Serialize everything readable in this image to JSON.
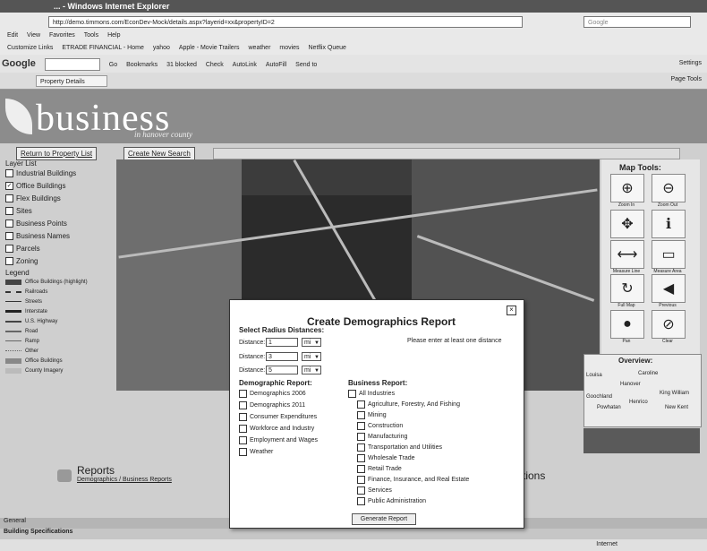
{
  "browser": {
    "title": "... - Windows Internet Explorer",
    "url": "http://demo.timmons.com/EconDev-Mock/details.aspx?layerid=xx&propertyID=2",
    "search_placeholder": "Google",
    "menu": [
      "Edit",
      "View",
      "Favorites",
      "Tools",
      "Help"
    ],
    "links": [
      "Customize Links",
      "ETRADE FINANCIAL - Home",
      "yahoo",
      "Apple - Movie Trailers",
      "weather",
      "movies",
      "Netflix Queue"
    ],
    "google_label": "Google",
    "google_items": [
      "Go",
      "Bookmarks",
      "31 blocked",
      "Check",
      "AutoLink",
      "AutoFill",
      "Send to"
    ],
    "settings": "Settings",
    "tab_label": "Property Details",
    "tab_right": "Page  Tools"
  },
  "site": {
    "logo": "business",
    "tagline": "in hanover county"
  },
  "nav": {
    "return_button": "Return to Property List",
    "new_search_button": "Create New Search"
  },
  "layers": {
    "title": "Layer List",
    "items": [
      {
        "label": "Industrial Buildings",
        "checked": false
      },
      {
        "label": "Office Buildings",
        "checked": true
      },
      {
        "label": "Flex Buildings",
        "checked": false
      },
      {
        "label": "Sites",
        "checked": false
      },
      {
        "label": "Business Points",
        "checked": false
      },
      {
        "label": "Business Names",
        "checked": false
      },
      {
        "label": "Parcels",
        "checked": false
      },
      {
        "label": "Zoning",
        "checked": false
      },
      {
        "label": "County boundary",
        "checked": false
      }
    ]
  },
  "legend": {
    "title": "Legend",
    "items": [
      "Office Buildings (highlight)",
      "Railroads",
      "Streets",
      "Interstate",
      "U.S. Highway",
      "Road",
      "Ramp",
      "Other",
      "Office Buildings",
      "County Imagery"
    ]
  },
  "map_tools": {
    "title": "Map Tools:",
    "tools": [
      "Zoom In",
      "Zoom Out",
      "Pan",
      "Identify",
      "Measure Line",
      "Measure Area",
      "Full Map",
      "Previous",
      "Pan",
      "Clear"
    ],
    "overview_title": "Overview:",
    "overview_labels": [
      "Louisa",
      "Caroline",
      "Hanover",
      "King William",
      "Goochland",
      "Powhatan",
      "New Kent",
      "Henrico"
    ]
  },
  "reports": {
    "title": "Reports",
    "link": "Demographics / Business Reports",
    "options_title": "Options"
  },
  "footer": {
    "general": "General",
    "building_specs": "Building Specifications",
    "status": "Internet"
  },
  "dialog": {
    "title": "Create Demographics Report",
    "radius_header": "Select Radius Distances:",
    "distances": [
      {
        "label": "Distance:",
        "value": "1",
        "unit": "mi"
      },
      {
        "label": "Distance:",
        "value": "3",
        "unit": "mi"
      },
      {
        "label": "Distance:",
        "value": "5",
        "unit": "mi"
      }
    ],
    "warning": "Please enter at least one distance",
    "demo_header": "Demographic Report:",
    "demo_options": [
      "Demographics 2006",
      "Demographics 2011",
      "Consumer Expenditures",
      "Workforce and Industry",
      "Employment and Wages",
      "Weather"
    ],
    "biz_header": "Business Report:",
    "biz_options": [
      "All Industries",
      "Agriculture, Forestry, And Fishing",
      "Mining",
      "Construction",
      "Manufacturing",
      "Transportation and Utilities",
      "Wholesale Trade",
      "Retail Trade",
      "Finance, Insurance, and Real Estate",
      "Services",
      "Public Administration"
    ],
    "generate_button": "Generate Report"
  }
}
